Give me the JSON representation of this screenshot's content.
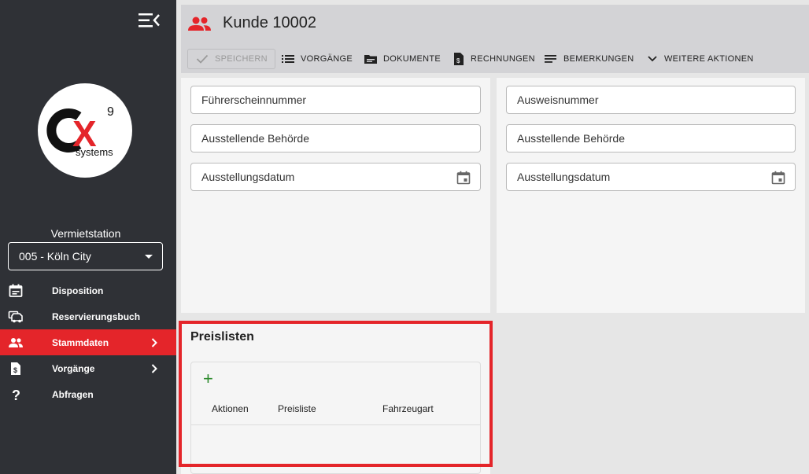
{
  "sidebar": {
    "station_label": "Vermietstation",
    "station_value": "005 - Köln City",
    "logo": {
      "mark": "CX",
      "superscript": "9",
      "text": "systems"
    },
    "nav": [
      {
        "label": "Disposition",
        "icon": "calendar-icon"
      },
      {
        "label": "Reservierungsbuch",
        "icon": "car-icon"
      },
      {
        "label": "Stammdaten",
        "icon": "people-icon",
        "active": true
      },
      {
        "label": "Vorgänge",
        "icon": "invoice-icon"
      },
      {
        "label": "Abfragen",
        "icon": "question-icon"
      }
    ]
  },
  "header": {
    "title": "Kunde 10002",
    "toolbar": {
      "save": "SPEICHERN",
      "vorgaenge": "VORGÄNGE",
      "dokumente": "DOKUMENTE",
      "rechnungen": "RECHNUNGEN",
      "bemerkungen": "BEMERKUNGEN",
      "weitere": "WEITERE AKTIONEN"
    }
  },
  "left_panel": {
    "fields": [
      "Führerscheinnummer",
      "Ausstellende Behörde",
      "Ausstellungsdatum"
    ]
  },
  "right_panel": {
    "fields": [
      "Ausweisnummer",
      "Ausstellende Behörde",
      "Ausstellungsdatum"
    ]
  },
  "preislisten": {
    "title": "Preislisten",
    "add": "+",
    "columns": [
      "Aktionen",
      "Preisliste",
      "Fahrzeugart"
    ]
  },
  "colors": {
    "accent": "#e4252a",
    "sidebar": "#2f3136",
    "add": "#2e8b2e"
  }
}
